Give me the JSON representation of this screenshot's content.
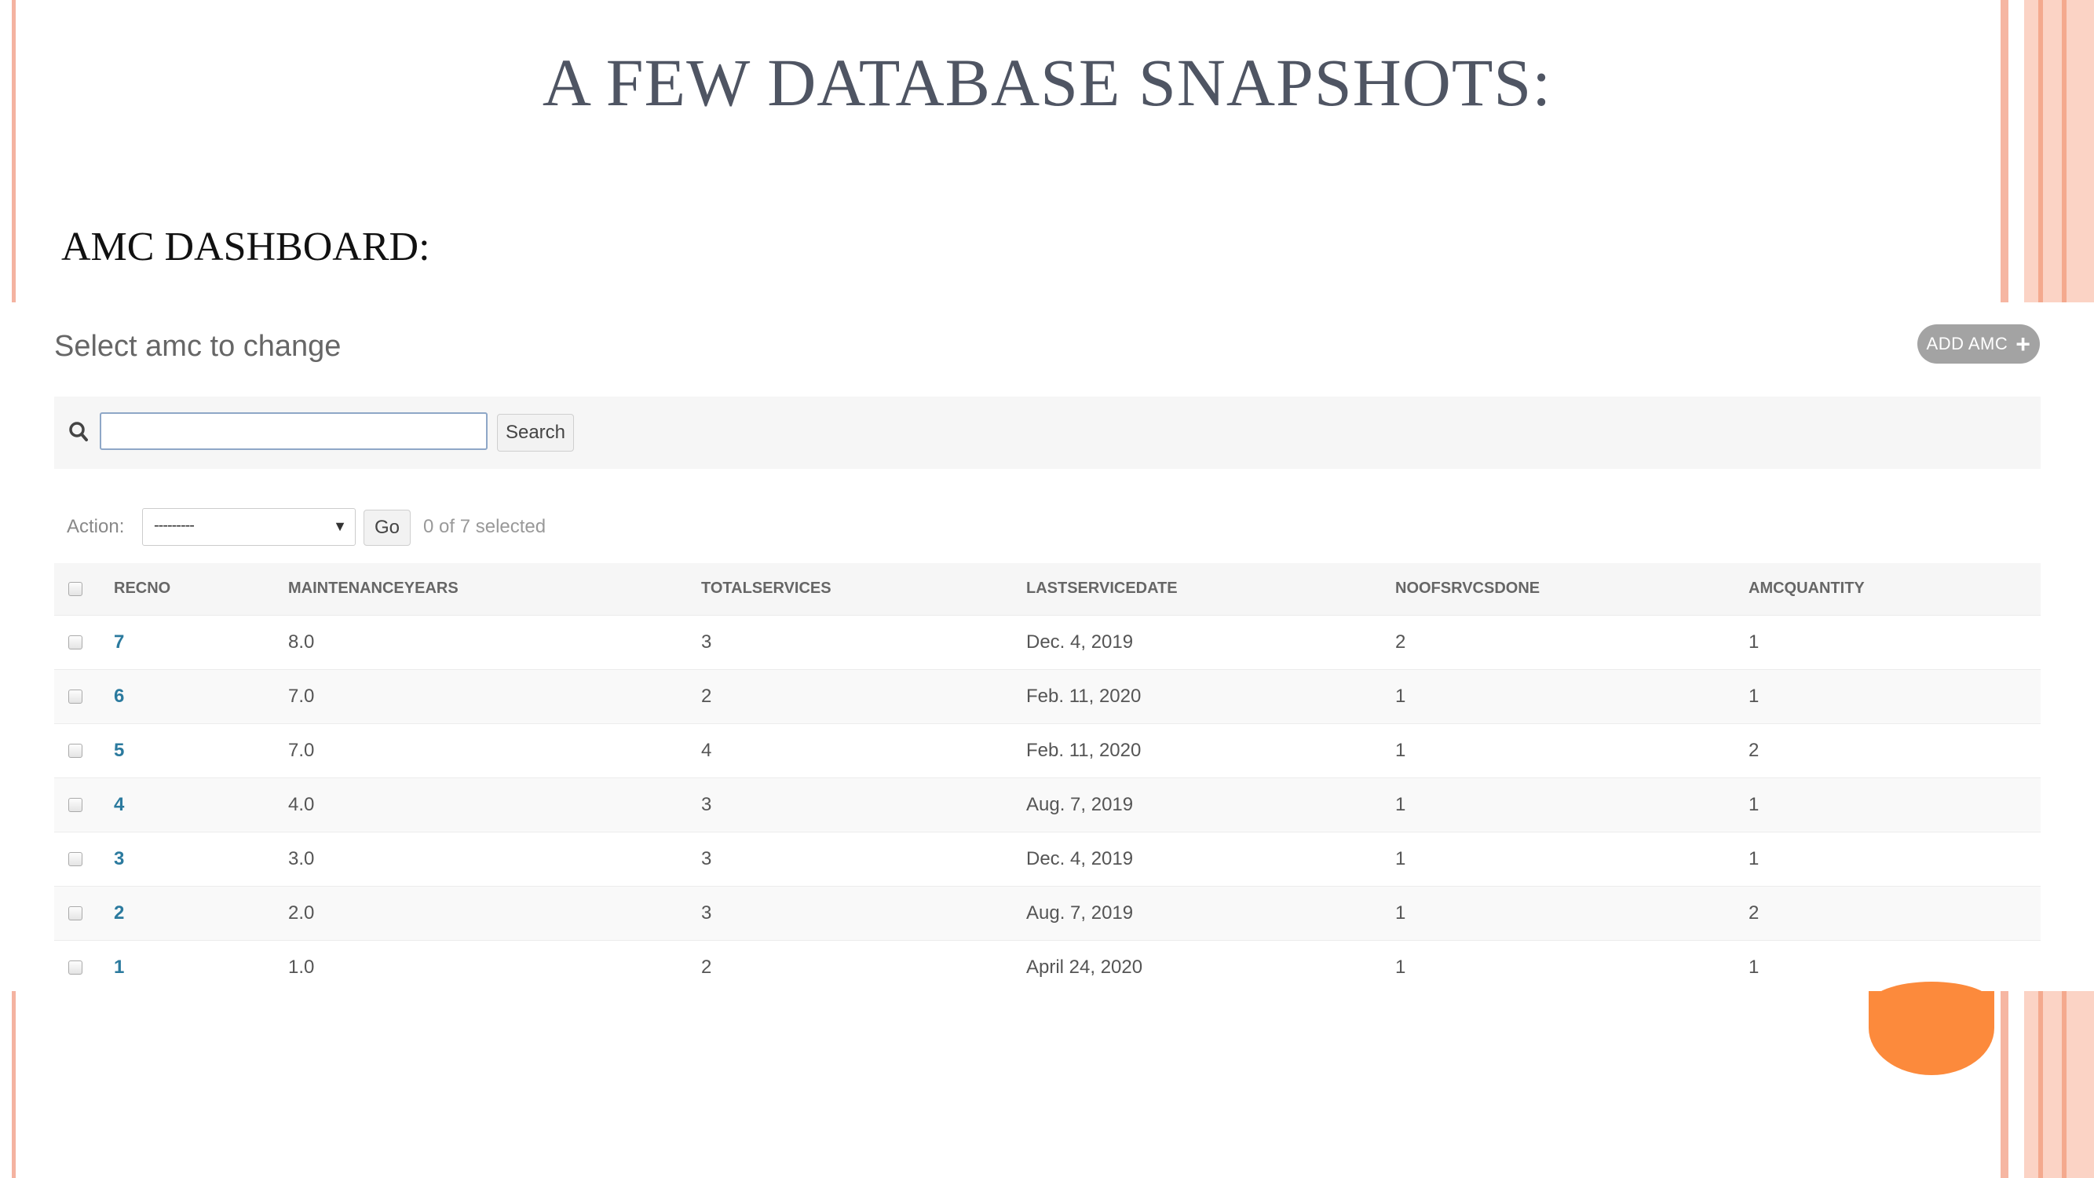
{
  "slide": {
    "title": "A FEW DATABASE SNAPSHOTS:",
    "section_label": "AMC DASHBOARD:"
  },
  "admin": {
    "page_heading": "Select amc to change",
    "add_button_label": "ADD AMC",
    "add_button_icon": "plus-icon",
    "search": {
      "icon": "search-icon",
      "value": "",
      "button_label": "Search"
    },
    "actions": {
      "label": "Action:",
      "selected_value": "---------",
      "go_label": "Go",
      "selected_count": "0 of 7 selected"
    },
    "table": {
      "headers": [
        "RECNO",
        "MAINTENANCEYEARS",
        "TOTALSERVICES",
        "LASTSERVICEDATE",
        "NOOFSRVCSDONE",
        "AMCQUANTITY"
      ],
      "rows": [
        [
          "7",
          "8.0",
          "3",
          "Dec. 4, 2019",
          "2",
          "1"
        ],
        [
          "6",
          "7.0",
          "2",
          "Feb. 11, 2020",
          "1",
          "1"
        ],
        [
          "5",
          "7.0",
          "4",
          "Feb. 11, 2020",
          "1",
          "2"
        ],
        [
          "4",
          "4.0",
          "3",
          "Aug. 7, 2019",
          "1",
          "1"
        ],
        [
          "3",
          "3.0",
          "3",
          "Dec. 4, 2019",
          "1",
          "1"
        ],
        [
          "2",
          "2.0",
          "3",
          "Aug. 7, 2019",
          "1",
          "2"
        ],
        [
          "1",
          "1.0",
          "2",
          "April 24, 2020",
          "1",
          "1"
        ]
      ]
    }
  },
  "colors": {
    "title_text": "#4f5563",
    "link": "#2b7a9e",
    "accent_orange": "#fc8a3c",
    "stripe_peach": "#fbd3c5"
  }
}
